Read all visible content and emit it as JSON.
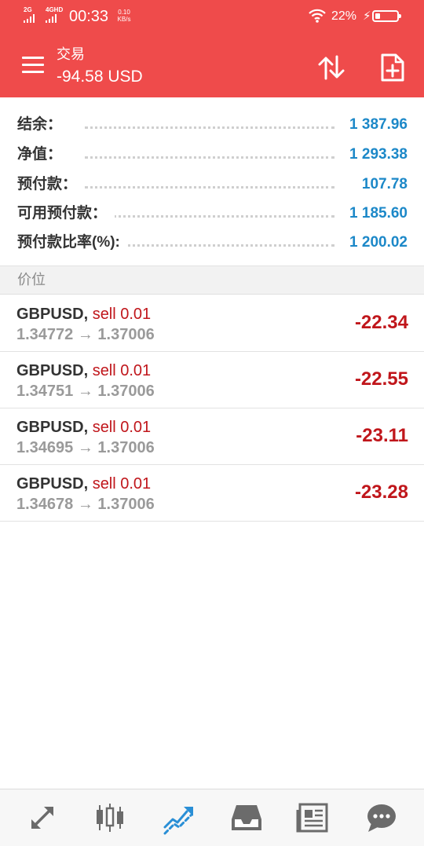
{
  "status_bar": {
    "sim1": "2G",
    "sim2": "4GHD",
    "time": "00:33",
    "speed_value": "0.10",
    "speed_unit": "KB/s",
    "battery_percent": "22%",
    "battery_level": 0.22
  },
  "app_bar": {
    "title": "交易",
    "subtitle": "-94.58 USD",
    "menu_icon": "hamburger-icon",
    "sort_icon": "sort-arrows-icon",
    "new_order_icon": "new-document-icon"
  },
  "summary": [
    {
      "label": "结余：",
      "value": "1 387.96"
    },
    {
      "label": "净值：",
      "value": "1 293.38"
    },
    {
      "label": "预付款：",
      "value": "107.78"
    },
    {
      "label": "可用预付款：",
      "value": "1 185.60"
    },
    {
      "label": "预付款比率(%):",
      "value": "1 200.02"
    }
  ],
  "section_title": "价位",
  "positions": [
    {
      "symbol": "GBPUSD,",
      "side": "sell 0.01",
      "prices": "1.34772 → 1.37006",
      "profit": "-22.34"
    },
    {
      "symbol": "GBPUSD,",
      "side": "sell 0.01",
      "prices": "1.34751 → 1.37006",
      "profit": "-22.55"
    },
    {
      "symbol": "GBPUSD,",
      "side": "sell 0.01",
      "prices": "1.34695 → 1.37006",
      "profit": "-23.11"
    },
    {
      "symbol": "GBPUSD,",
      "side": "sell 0.01",
      "prices": "1.34678 → 1.37006",
      "profit": "-23.28"
    }
  ],
  "bottom_nav": [
    {
      "icon": "quotes-arrows-icon",
      "active": false
    },
    {
      "icon": "candlestick-chart-icon",
      "active": false
    },
    {
      "icon": "trade-trend-icon",
      "active": true
    },
    {
      "icon": "inbox-history-icon",
      "active": false
    },
    {
      "icon": "news-icon",
      "active": false
    },
    {
      "icon": "chat-bubble-icon",
      "active": false
    }
  ],
  "colors": {
    "header": "#ef4b4b",
    "value_blue": "#1c88c8",
    "loss_red": "#c0161b",
    "nav_active": "#2a8fd6",
    "nav_inactive": "#6b6b6b"
  }
}
